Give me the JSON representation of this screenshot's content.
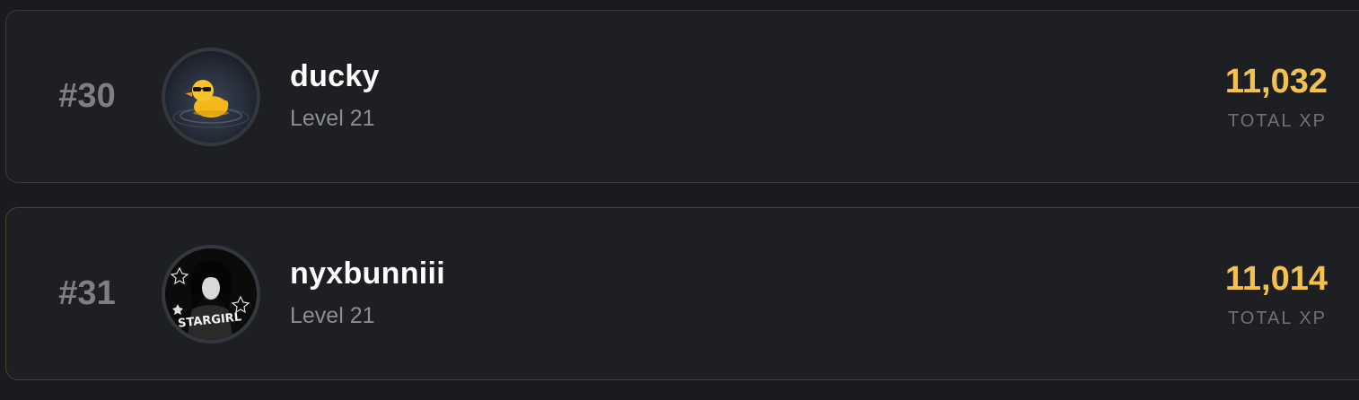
{
  "leaderboard": {
    "entries": [
      {
        "rank": "#30",
        "username": "ducky",
        "level": "Level 21",
        "xp": "11,032",
        "xp_label": "TOTAL XP",
        "avatar": "duck-with-sunglasses-avatar"
      },
      {
        "rank": "#31",
        "username": "nyxbunniii",
        "level": "Level 21",
        "xp": "11,014",
        "xp_label": "TOTAL XP",
        "avatar": "black-and-white-stargirl-avatar",
        "avatar_text": "STARGIRL"
      }
    ]
  },
  "colors": {
    "background": "#1a1b1e",
    "card": "#1d1f23",
    "xp_accent": "#f2c14e",
    "rank_text": "#7d7f84"
  }
}
